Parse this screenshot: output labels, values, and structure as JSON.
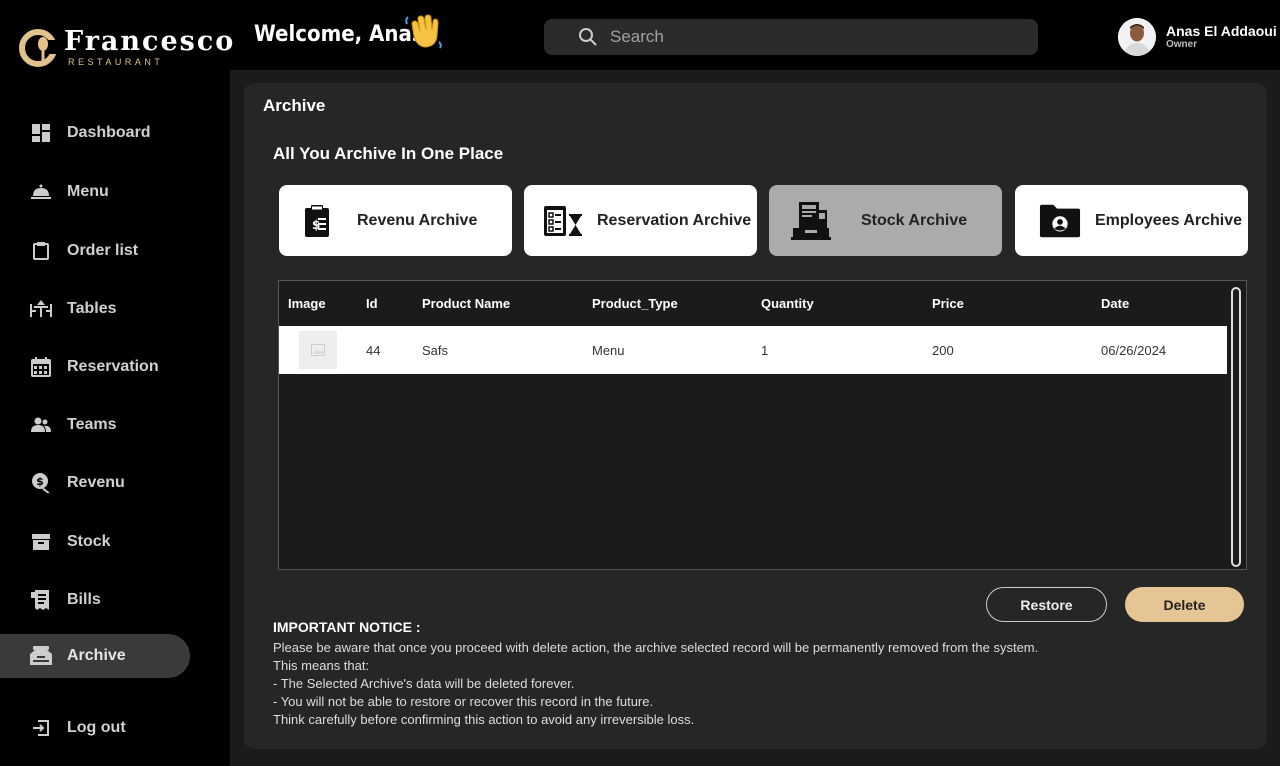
{
  "brand": {
    "name": "Francesco",
    "subtitle": "RESTAURANT",
    "accent": "#e2c28c"
  },
  "header": {
    "welcome": "Welcome, Anas",
    "wave_icon": "waving-hand-icon",
    "search": {
      "placeholder": "Search",
      "value": ""
    },
    "user": {
      "name": "Anas El Addaoui",
      "role": "Owner"
    }
  },
  "sidebar": {
    "items": [
      {
        "label": "Dashboard",
        "icon": "dashboard-icon",
        "active": false
      },
      {
        "label": "Menu",
        "icon": "cloche-icon",
        "active": false
      },
      {
        "label": "Order list",
        "icon": "clipboard-icon",
        "active": false
      },
      {
        "label": "Tables",
        "icon": "table-icon",
        "active": false
      },
      {
        "label": "Reservation",
        "icon": "calendar-icon",
        "active": false
      },
      {
        "label": "Teams",
        "icon": "team-icon",
        "active": false
      },
      {
        "label": "Revenu",
        "icon": "revenue-icon",
        "active": false
      },
      {
        "label": "Stock",
        "icon": "box-icon",
        "active": false
      },
      {
        "label": "Bills",
        "icon": "receipt-icon",
        "active": false
      },
      {
        "label": "Archive",
        "icon": "archive-icon",
        "active": true
      }
    ],
    "logout": "Log out"
  },
  "page": {
    "title": "Archive",
    "subtitle": "All You Archive In One Place",
    "tabs": [
      {
        "label": "Revenu Archive",
        "icon": "revenue-document-icon",
        "active": false
      },
      {
        "label": "Reservation Archive",
        "icon": "reservation-checklist-icon",
        "active": false
      },
      {
        "label": "Stock Archive",
        "icon": "stock-register-icon",
        "active": true
      },
      {
        "label": "Employees Archive",
        "icon": "employee-folder-icon",
        "active": false
      }
    ]
  },
  "table": {
    "columns": [
      "Image",
      "Id",
      "Product Name",
      "Product_Type",
      "Quantity",
      "Price",
      "Date"
    ],
    "rows": [
      {
        "id": "44",
        "product_name": "Safs",
        "product_type": "Menu",
        "quantity": "1",
        "price": "200",
        "date": "06/26/2024"
      }
    ]
  },
  "actions": {
    "restore": "Restore",
    "delete": "Delete",
    "delete_color": "#e6c594"
  },
  "notice": {
    "title": "IMPORTANT NOTICE :",
    "lines": [
      "Please be aware that once you proceed with delete action, the archive selected record will be permanently removed from the system.",
      "This means that:",
      "- The Selected Archive's data will be deleted forever.",
      "- You will not be able to restore or recover this record in the future.",
      "Think carefully before confirming this action to avoid any irreversible loss."
    ]
  }
}
